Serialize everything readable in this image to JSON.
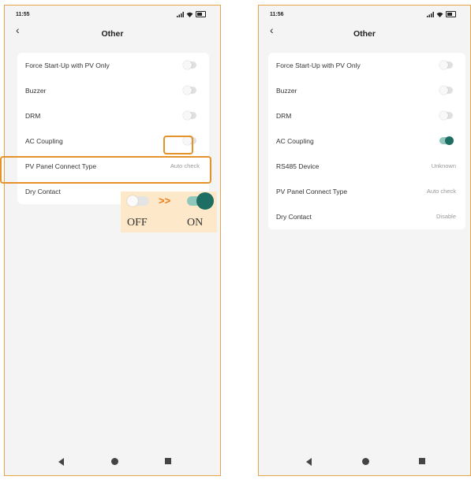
{
  "left_screen": {
    "time": "11:55",
    "title": "Other",
    "rows": [
      {
        "label": "Force Start-Up with PV Only",
        "control": "toggle",
        "on": false
      },
      {
        "label": "Buzzer",
        "control": "toggle",
        "on": false
      },
      {
        "label": "DRM",
        "control": "toggle",
        "on": false
      },
      {
        "label": "AC Coupling",
        "control": "toggle",
        "on": false
      },
      {
        "label": "PV Panel Connect Type",
        "control": "value",
        "value": "Auto check"
      },
      {
        "label": "Dry Contact",
        "control": "none"
      }
    ]
  },
  "callout": {
    "arrows": ">>",
    "off_label": "OFF",
    "on_label": "ON"
  },
  "right_screen": {
    "time": "11:56",
    "title": "Other",
    "rows": [
      {
        "label": "Force Start-Up with PV Only",
        "control": "toggle",
        "on": false
      },
      {
        "label": "Buzzer",
        "control": "toggle",
        "on": false
      },
      {
        "label": "DRM",
        "control": "toggle",
        "on": false
      },
      {
        "label": "AC Coupling",
        "control": "toggle",
        "on": true
      },
      {
        "label": "RS485 Device",
        "control": "value",
        "value": "Unknown"
      },
      {
        "label": "PV Panel Connect Type",
        "control": "value",
        "value": "Auto check"
      },
      {
        "label": "Dry Contact",
        "control": "value",
        "value": "Disable"
      }
    ]
  },
  "colors": {
    "accent_orange": "#e6922a",
    "toggle_on": "#1e6e63",
    "callout_bg": "#fde8c9"
  },
  "icons": {
    "back": "chevron-left-icon",
    "status": [
      "signal-icon",
      "wifi-icon",
      "battery-icon"
    ],
    "nav": [
      "nav-back-icon",
      "nav-home-icon",
      "nav-recent-icon"
    ]
  }
}
